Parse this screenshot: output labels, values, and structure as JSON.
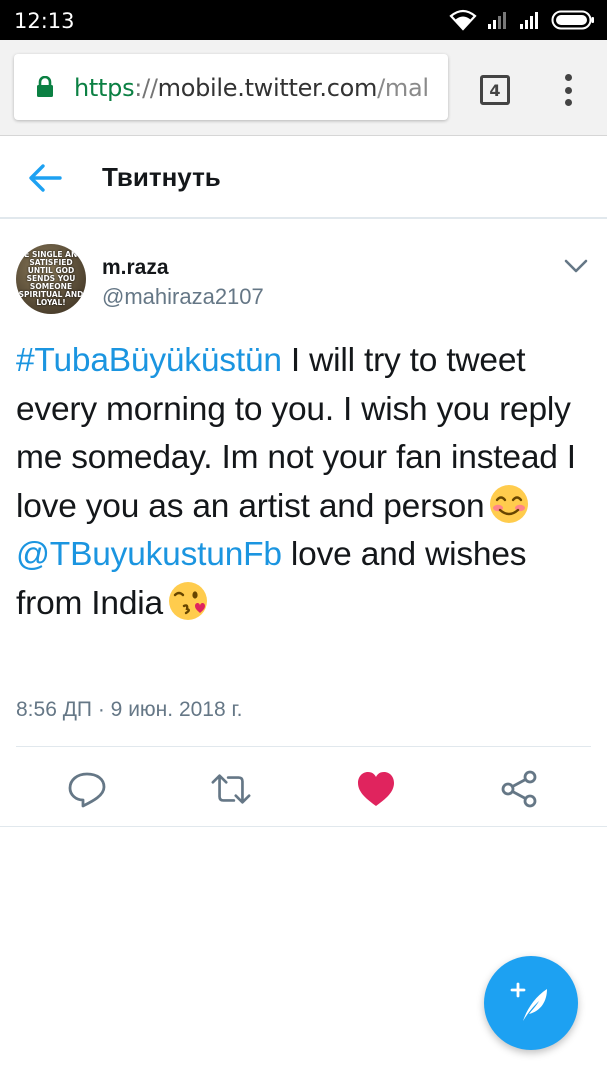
{
  "status_bar": {
    "time": "12:13",
    "icons": [
      "wifi-icon",
      "signal-icon",
      "signal-icon",
      "battery-icon"
    ]
  },
  "browser": {
    "url_scheme": "https",
    "url_sep": "://",
    "url_host": "mobile.twitter.com",
    "url_path": "/mal",
    "tab_count": "4",
    "lock_color": "#0b8043"
  },
  "header": {
    "title": "Твитнуть"
  },
  "tweet": {
    "avatar_text": "BE SINGLE AND SATISFIED UNTIL GOD SENDS YOU SOMEONE SPIRITUAL AND LOYAL!",
    "display_name": "m.raza",
    "username": "@mahiraza2107",
    "hashtag": "#TubaBüyüküstün",
    "text_part1": " I will try to tweet every morning to you. I wish you reply me someday. Im not your fan instead I love you as an artist and person",
    "mention": "@TBuyukustunFb",
    "text_part2": " love and wishes from India",
    "timestamp": "8:56 ДП · 9 июн. 2018 г.",
    "liked": true,
    "like_color": "#e0245e",
    "link_color": "#1b95e0"
  },
  "actions": [
    "reply-icon",
    "retweet-icon",
    "like-icon",
    "share-icon"
  ],
  "fab": {
    "icon": "compose-tweet-icon",
    "color": "#1da1f2"
  }
}
